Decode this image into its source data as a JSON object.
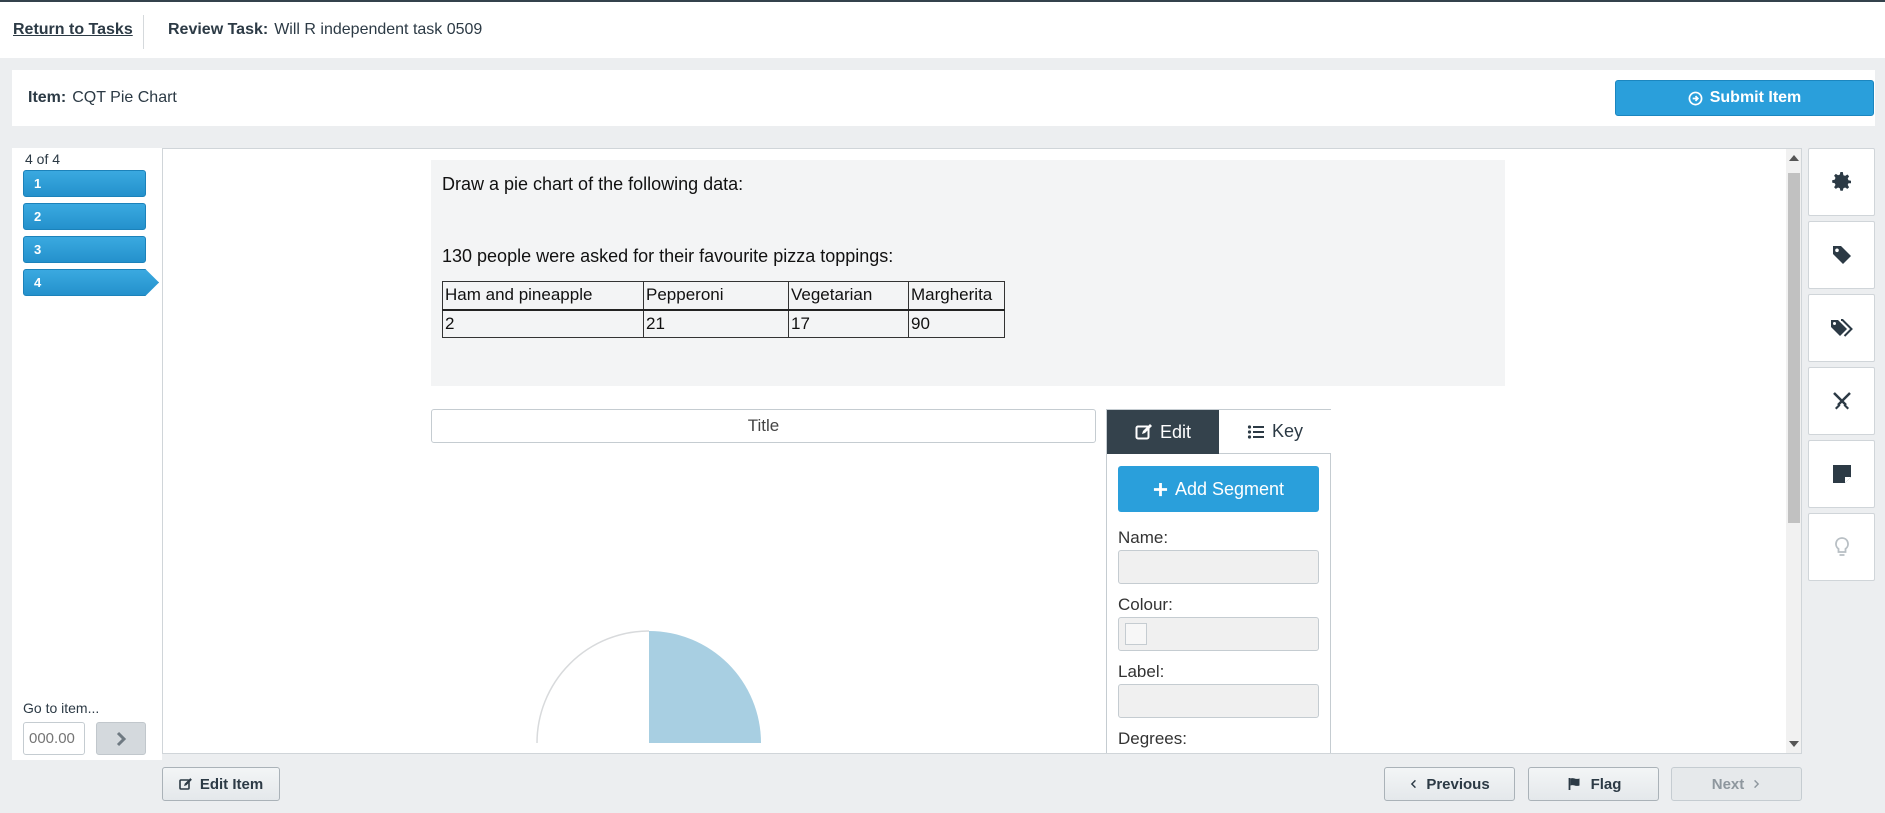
{
  "topbar": {
    "return_label": "Return to Tasks",
    "review_label": "Review Task:",
    "review_value": "Will R independent task 0509"
  },
  "itembar": {
    "item_label": "Item:",
    "item_value": "CQT Pie Chart",
    "submit_label": "Submit Item"
  },
  "nav": {
    "counter": "4 of 4",
    "items": [
      {
        "label": "1"
      },
      {
        "label": "2"
      },
      {
        "label": "3"
      },
      {
        "label": "4"
      }
    ],
    "goto_label": "Go to item...",
    "goto_placeholder": "000.00"
  },
  "question": {
    "line1": "Draw a pie chart of the following data:",
    "line2": "130 people were asked for their favourite pizza toppings:",
    "table": {
      "headers": [
        "Ham and pineapple",
        "Pepperoni",
        "Vegetarian",
        "Margherita"
      ],
      "values": [
        "2",
        "21",
        "17",
        "90"
      ]
    }
  },
  "chart": {
    "title_placeholder": "Title",
    "segment_color": "#a8cfe2",
    "segment_fraction": 0.25
  },
  "edit_panel": {
    "tab_edit": "Edit",
    "tab_key": "Key",
    "add_segment": "Add Segment",
    "name_label": "Name:",
    "colour_label": "Colour:",
    "label_label": "Label:",
    "degrees_label": "Degrees:"
  },
  "tools": [
    "gear-icon",
    "tag-icon",
    "tags-icon",
    "cross-swords-icon",
    "sticky-note-icon",
    "lightbulb-icon"
  ],
  "bottom": {
    "edit_item": "Edit Item",
    "previous": "Previous",
    "flag": "Flag",
    "next": "Next"
  }
}
